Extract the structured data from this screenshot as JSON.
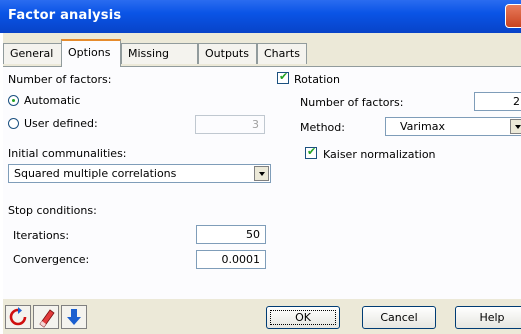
{
  "window": {
    "title": "Factor analysis"
  },
  "tabs": [
    {
      "label": "General"
    },
    {
      "label": "Options",
      "active": true
    },
    {
      "label": "Missing data"
    },
    {
      "label": "Outputs"
    },
    {
      "label": "Charts"
    }
  ],
  "left": {
    "number_of_factors_label": "Number of factors:",
    "automatic_label": "Automatic",
    "automatic_selected": true,
    "user_defined_label": "User defined:",
    "user_defined_value": "3",
    "communalities_label": "Initial communalities:",
    "communalities_value": "Squared multiple correlations",
    "stop_label": "Stop conditions:",
    "iterations_label": "Iterations:",
    "iterations_value": "50",
    "convergence_label": "Convergence:",
    "convergence_value": "0.0001"
  },
  "right": {
    "rotation_label": "Rotation",
    "rotation_checked": true,
    "num_factors_label": "Number of factors:",
    "num_factors_value": "2",
    "method_label": "Method:",
    "method_value": "Varimax",
    "kaiser_label": "Kaiser normalization",
    "kaiser_checked": true
  },
  "footer": {
    "icons": [
      "reset-icon",
      "eraser-icon",
      "down-arrow-icon"
    ],
    "ok_label": "OK",
    "cancel_label": "Cancel",
    "help_label": "Help"
  },
  "colors": {
    "title_bar": "#0a54e6",
    "dialog_bg": "#ece9d8",
    "panel_bg": "#fcfcfe",
    "active_tab_accent": "#e68b2c"
  }
}
